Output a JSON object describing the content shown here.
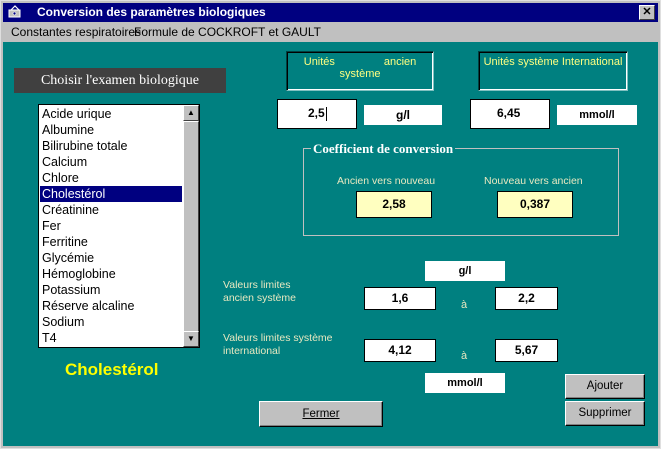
{
  "window": {
    "title": "Conversion des paramètres biologiques",
    "close_label": "✕"
  },
  "menu": {
    "items": [
      "Constantes respiratoires",
      "Formule de COCKROFT et GAULT"
    ]
  },
  "choose_label": "Choisir l'examen biologique",
  "exam_list": {
    "items": [
      "Acide urique",
      "Albumine",
      "Bilirubine totale",
      "Calcium",
      "Chlore",
      "Cholestérol",
      "Créatinine",
      "Fer",
      "Ferritine",
      "Glycémie",
      "Hémoglobine",
      "Potassium",
      "Réserve alcaline",
      "Sodium",
      "T4"
    ],
    "selected": "Cholestérol"
  },
  "selected_exam": "Cholestérol",
  "units": {
    "old_header": "Unités                ancien système",
    "si_header": "Unités système International",
    "old_value": "2,5",
    "old_unit": "g/l",
    "si_value": "6,45",
    "si_unit": "mmol/l"
  },
  "coefficient": {
    "title": "Coefficient de conversion",
    "old_to_new_label": "Ancien vers nouveau",
    "new_to_old_label": "Nouveau vers ancien",
    "old_to_new_value": "2,58",
    "new_to_old_value": "0,387"
  },
  "limits": {
    "old_unit": "g/l",
    "old_label_line1": "Valeurs limites",
    "old_label_line2": "ancien système",
    "old_min": "1,6",
    "old_max": "2,2",
    "si_label_line1": "Valeurs limites système",
    "si_label_line2": "international",
    "si_min": "4,12",
    "si_max": "5,67",
    "si_unit": "mmol/l",
    "to_word": "à"
  },
  "buttons": {
    "close": "Fermer",
    "add": "Ajouter",
    "delete": "Supprimer"
  },
  "colors": {
    "client_bg": "#008080",
    "title_bar": "#000080",
    "selected_exam_text": "#ffff00"
  }
}
